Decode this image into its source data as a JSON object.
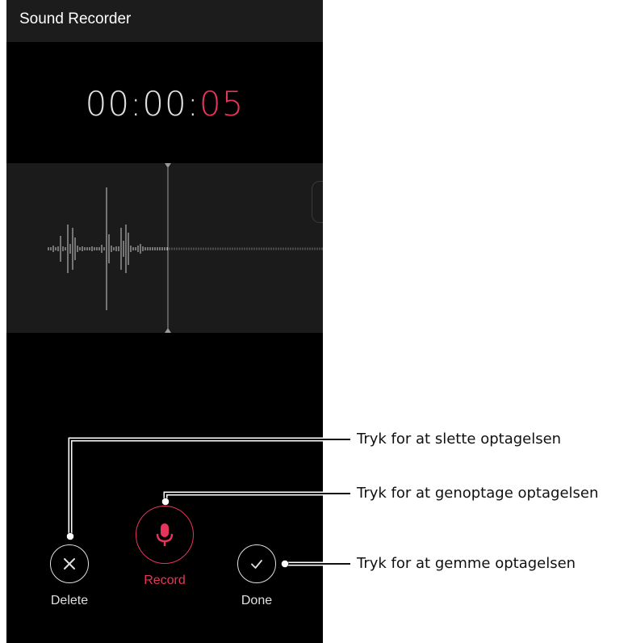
{
  "app": {
    "title": "Sound Recorder"
  },
  "timer": {
    "prefix": "00:00:",
    "seconds": "05"
  },
  "controls": {
    "delete_label": "Delete",
    "record_label": "Record",
    "done_label": "Done"
  },
  "annotations": {
    "delete": "Tryk for at slette optagelsen",
    "record": "Tryk for at genoptage optagelsen",
    "done": "Tryk for at gemme optagelsen"
  },
  "colors": {
    "accent": "#e8345a",
    "background": "#000000",
    "appbar": "#1c1c1c",
    "waveform_panel": "#1b1b1b"
  }
}
